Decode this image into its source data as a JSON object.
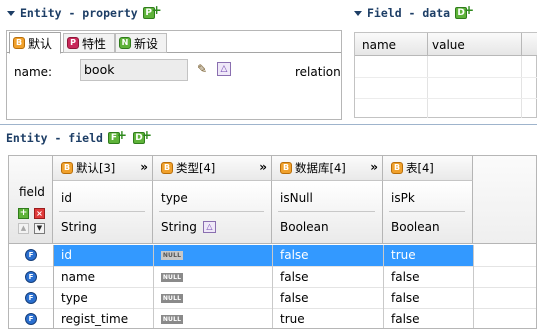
{
  "entity_property": {
    "title": "Entity - property",
    "tabs": [
      {
        "label": "默认",
        "icon": "B",
        "color": "#f0a12c"
      },
      {
        "label": "特性",
        "icon": "P",
        "color": "#c8285a"
      },
      {
        "label": "新设",
        "icon": "N",
        "color": "#5fb33a"
      }
    ],
    "name_label": "name:",
    "name_value": "book",
    "relation_label": "relation"
  },
  "field_data": {
    "title": "Field - data",
    "columns": [
      "name",
      "value"
    ]
  },
  "entity_field": {
    "title": "Entity - field",
    "row_header_label": "field",
    "groups": [
      {
        "label": "默认[3]",
        "icon": "B",
        "chevron": "»"
      },
      {
        "label": "类型[4]",
        "icon": "B",
        "chevron": "»"
      },
      {
        "label": "数据库[4]",
        "icon": "B",
        "chevron": "»"
      },
      {
        "label": "表[4]",
        "icon": "B",
        "chevron": ""
      }
    ],
    "columns": [
      {
        "name": "id",
        "type": "String"
      },
      {
        "name": "type",
        "type": "String"
      },
      {
        "name": "isNull",
        "type": "Boolean"
      },
      {
        "name": "isPk",
        "type": "Boolean"
      }
    ],
    "null_badge": "NULL",
    "rows": [
      {
        "icon": "F",
        "id": "id",
        "isNull": "false",
        "isPk": "true",
        "selected": true
      },
      {
        "icon": "F",
        "id": "name",
        "isNull": "false",
        "isPk": "false",
        "selected": false
      },
      {
        "icon": "F",
        "id": "type",
        "isNull": "false",
        "isPk": "false",
        "selected": false
      },
      {
        "icon": "F",
        "id": "regist_time",
        "isNull": "true",
        "isPk": "false",
        "selected": false
      }
    ]
  },
  "colors": {
    "title_text": "#1d3e66",
    "selection": "#3399ff",
    "panel_border": "#9fb4cc"
  }
}
